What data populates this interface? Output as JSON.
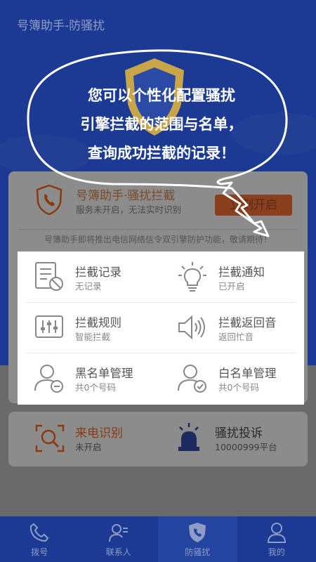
{
  "header": {
    "title": "号簿助手-防骚扰"
  },
  "bubble": {
    "lines": [
      "您可以个性化配置骚扰",
      "引擎拦截的范围与名单，",
      "查询成功拦截的记录！"
    ]
  },
  "intercept_card": {
    "title": "号簿助手·骚扰拦截",
    "subtitle": "服务未开启，无法实时识别",
    "button_label": "立刻开启",
    "notice": "号簿助手即将推出电信网络信令双引擎防护功能，敬请期待！"
  },
  "grid": [
    {
      "title": "拦截记录",
      "sub": "无记录",
      "icon": "record-blocked-icon"
    },
    {
      "title": "拦截通知",
      "sub": "已开启",
      "icon": "lightbulb-icon"
    },
    {
      "title": "拦截规则",
      "sub": "智能拦截",
      "icon": "sliders-icon"
    },
    {
      "title": "拦截返回音",
      "sub": "返回忙音",
      "icon": "speaker-icon"
    },
    {
      "title": "黑名单管理",
      "sub": "共0个号码",
      "icon": "user-minus-icon"
    },
    {
      "title": "白名单管理",
      "sub": "共0个号码",
      "icon": "user-check-icon"
    }
  ],
  "bottom_card": {
    "left": {
      "title": "来电识别",
      "sub": "未开启",
      "icon": "caller-search-icon"
    },
    "right": {
      "title": "骚扰投诉",
      "sub": "10000999平台",
      "icon": "alarm-light-icon"
    }
  },
  "tabs": [
    {
      "label": "拨号",
      "icon": "phone-icon"
    },
    {
      "label": "联系人",
      "icon": "contacts-icon"
    },
    {
      "label": "防骚扰",
      "icon": "shield-phone-icon",
      "active": true
    },
    {
      "label": "我的",
      "icon": "person-icon"
    }
  ],
  "colors": {
    "primary": "#1c3a93",
    "accent": "#e8631f",
    "overlay": "#6f6f6f"
  }
}
